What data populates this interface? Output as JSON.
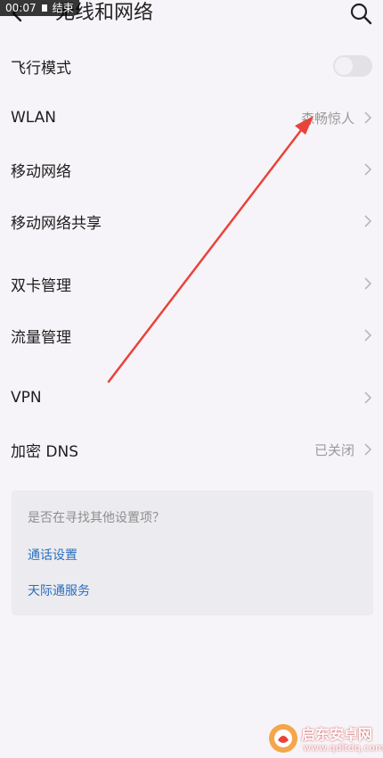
{
  "header": {
    "title": "无线和网络",
    "back_icon": "chevron-left-icon",
    "search_icon": "search-icon"
  },
  "recording_badge": {
    "time": "00:07",
    "action": "结束"
  },
  "settings": {
    "airplane": {
      "label": "飞行模式",
      "toggle_on": false
    },
    "wlan": {
      "label": "WLAN",
      "value": "森畅惊人"
    },
    "mobile_network": {
      "label": "移动网络"
    },
    "hotspot": {
      "label": "移动网络共享"
    },
    "dual_sim": {
      "label": "双卡管理"
    },
    "data_usage": {
      "label": "流量管理"
    },
    "vpn": {
      "label": "VPN"
    },
    "private_dns": {
      "label": "加密 DNS",
      "value": "已关闭"
    }
  },
  "suggestions": {
    "title": "是否在寻找其他设置项？",
    "links": [
      "通话设置",
      "天际通服务"
    ]
  },
  "annotation": {
    "color": "#e8433a"
  },
  "watermark": {
    "name": "启东安卓网",
    "url": "www.qdltdq.com"
  },
  "colors": {
    "background": "#f6f4f8",
    "link": "#2a6fbf",
    "secondary_text": "#9a9a9a"
  }
}
